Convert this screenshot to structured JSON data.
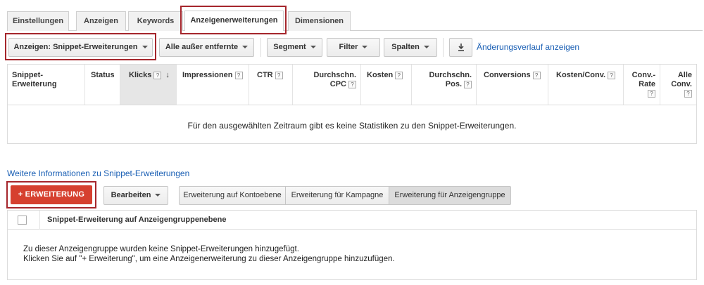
{
  "tabs": [
    {
      "label": "Einstellungen"
    },
    {
      "label": "Anzeigen"
    },
    {
      "label": "Keywords"
    },
    {
      "label": "Anzeigenerweiterungen"
    },
    {
      "label": "Dimensionen"
    }
  ],
  "toolbar": {
    "view_dropdown": "Anzeigen: Snippet-Erweiterungen",
    "status_dropdown": "Alle außer entfernte",
    "segment": "Segment",
    "filter": "Filter",
    "columns": "Spalten",
    "download_icon": "download-icon",
    "history_link": "Änderungsverlauf anzeigen"
  },
  "stats_table": {
    "columns": [
      {
        "line1": "Snippet-",
        "line2": "Erweiterung"
      },
      {
        "line1": "Status",
        "line2": ""
      },
      {
        "line1": "Klicks",
        "line2": ""
      },
      {
        "line1": "Impressionen",
        "line2": ""
      },
      {
        "line1": "CTR",
        "line2": ""
      },
      {
        "line1": "Durchschn.",
        "line2": "CPC"
      },
      {
        "line1": "Kosten",
        "line2": ""
      },
      {
        "line1": "Durchschn.",
        "line2": "Pos."
      },
      {
        "line1": "Conversions",
        "line2": ""
      },
      {
        "line1": "Kosten/Conv.",
        "line2": ""
      },
      {
        "line1": "Conv.-",
        "line2": "Rate"
      },
      {
        "line1": "Alle",
        "line2": "Conv."
      }
    ],
    "help_mark": "?",
    "sort_arrow": "↓",
    "empty_message": "Für den ausgewählten Zeitraum gibt es keine Statistiken zu den Snippet-Erweiterungen."
  },
  "info_link": "Weitere Informationen zu Snippet-Erweiterungen",
  "ext_toolbar": {
    "add_button": "+ ERWEITERUNG",
    "edit_dropdown": "Bearbeiten",
    "levels": [
      {
        "label": "Erweiterung auf Kontoebene"
      },
      {
        "label": "Erweiterung für Kampagne"
      },
      {
        "label": "Erweiterung für Anzeigengruppe"
      }
    ]
  },
  "ext_table": {
    "header": "Snippet-Erweiterung auf Anzeigengruppenebene",
    "message_line1": "Zu dieser Anzeigengruppe wurden keine Snippet-Erweiterungen hinzugefügt.",
    "message_line2": "Klicken Sie auf \"+ Erweiterung\", um eine Anzeigenerweiterung zu dieser Anzeigengruppe hinzuzufügen."
  },
  "colors": {
    "highlight": "#a5262c",
    "add_button": "#d6402f",
    "link": "#1a5fb4"
  }
}
